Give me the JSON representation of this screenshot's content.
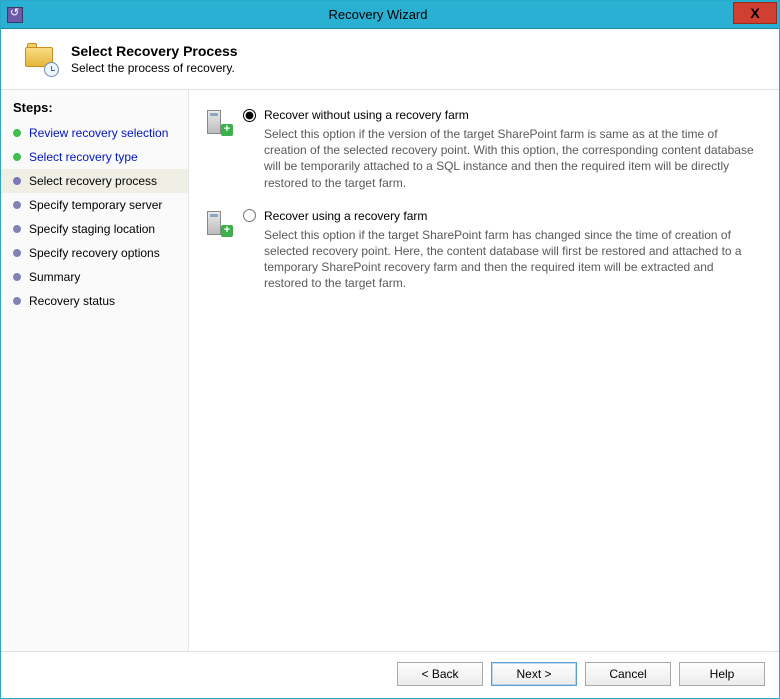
{
  "window": {
    "title": "Recovery Wizard",
    "close_glyph": "X"
  },
  "header": {
    "title": "Select Recovery Process",
    "subtitle": "Select the process of recovery."
  },
  "sidebar": {
    "title": "Steps:",
    "steps": [
      {
        "label": "Review recovery selection",
        "state": "done"
      },
      {
        "label": "Select recovery type",
        "state": "done"
      },
      {
        "label": "Select recovery process",
        "state": "current"
      },
      {
        "label": "Specify temporary server",
        "state": "pending"
      },
      {
        "label": "Specify staging location",
        "state": "pending"
      },
      {
        "label": "Specify recovery options",
        "state": "pending"
      },
      {
        "label": "Summary",
        "state": "pending"
      },
      {
        "label": "Recovery status",
        "state": "pending"
      }
    ]
  },
  "options": {
    "selected": 0,
    "items": [
      {
        "label": "Recover without using a recovery farm",
        "description": "Select this option if the version of the target SharePoint farm is same as at the time of creation of the selected recovery point. With this option, the corresponding content database will be temporarily attached to a SQL instance and then the required item will be directly restored to the target farm."
      },
      {
        "label": "Recover using a recovery farm",
        "description": "Select this option if the target SharePoint farm has changed since the time of creation of selected recovery point. Here, the content database will first be restored and attached to a temporary SharePoint recovery farm and then the required item will be extracted and restored to the target farm."
      }
    ]
  },
  "buttons": {
    "back": "< Back",
    "next": "Next >",
    "cancel": "Cancel",
    "help": "Help"
  },
  "icons": {
    "plus": "+"
  }
}
